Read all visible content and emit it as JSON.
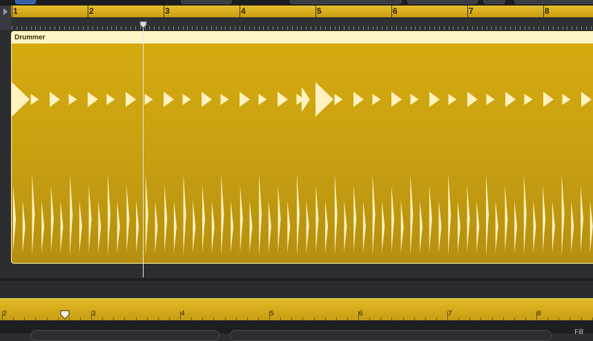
{
  "timeline": {
    "bar_numbers": [
      "1",
      "2",
      "3",
      "4",
      "5",
      "6",
      "7",
      "8"
    ]
  },
  "region": {
    "name": "Drummer",
    "color": "#cfa612",
    "header_color": "#fff5c7"
  },
  "playhead": {
    "position_bar": 2.73
  },
  "mini_ruler": {
    "bar_numbers": [
      "2",
      "3",
      "4",
      "5",
      "6",
      "7",
      "8"
    ]
  },
  "bottom": {
    "fill_label": "Fill"
  },
  "icons": [
    "disclosure-triangle-icon",
    "playhead-marker-icon",
    "position-marker-icon"
  ]
}
